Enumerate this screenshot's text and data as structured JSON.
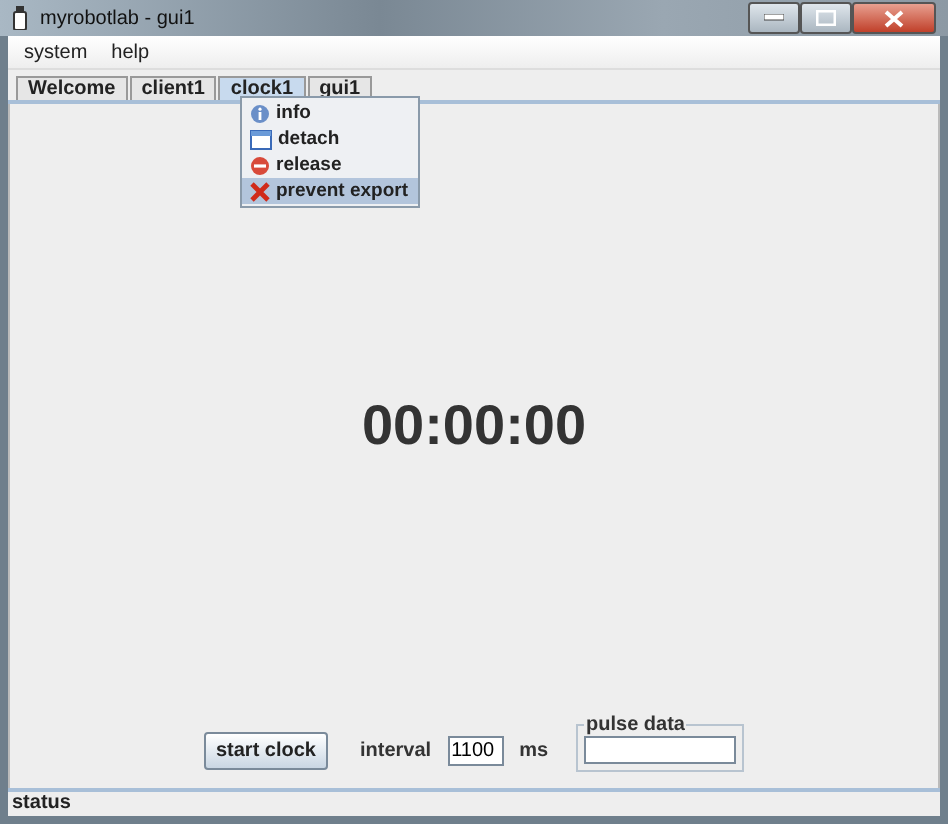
{
  "window": {
    "title": "myrobotlab - gui1"
  },
  "menu_bar": [
    "system",
    "help"
  ],
  "tabs": [
    {
      "label": "Welcome",
      "selected": false
    },
    {
      "label": "client1",
      "selected": false
    },
    {
      "label": "clock1",
      "selected": true
    },
    {
      "label": "gui1",
      "selected": false
    }
  ],
  "context_menu": [
    {
      "label": "info",
      "kind": "info",
      "selected": false
    },
    {
      "label": "detach",
      "kind": "window",
      "selected": false
    },
    {
      "label": "release",
      "kind": "remove",
      "selected": false
    },
    {
      "label": "prevent export",
      "kind": "cross",
      "selected": true
    }
  ],
  "clock": {
    "time": "00:00:00"
  },
  "controls": {
    "start_button": "start clock",
    "interval_label": "interval",
    "interval_value": "1100",
    "unit": "ms",
    "pulse_data": {
      "legend": "pulse data"
    }
  },
  "status_bar": "status"
}
